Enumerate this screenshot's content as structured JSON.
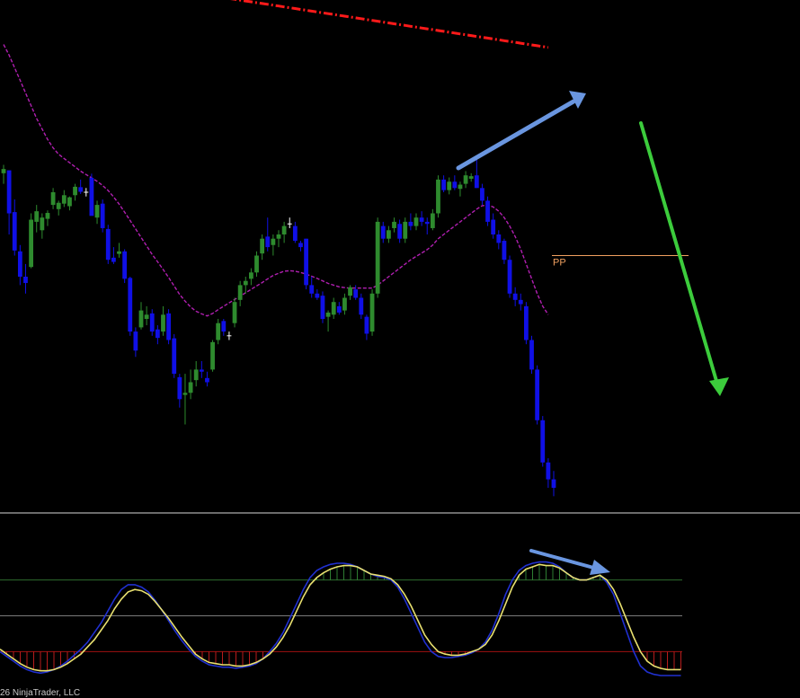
{
  "chart_data": [
    {
      "type": "candlestick",
      "panel": "price",
      "colors": {
        "up": "#2e8b2e",
        "down": "#1010e6",
        "doji": "#ffffff",
        "ma_short": "#b01fb0",
        "ma_long": "#ff1a1a",
        "pp_line": "#f0a060",
        "arrow_up": "#6a96e0",
        "arrow_down": "#3ccc3c"
      },
      "candles": [
        [
          64.5,
          66.5,
          62.0,
          65.5
        ],
        [
          65.2,
          65.0,
          50.0,
          55.0
        ],
        [
          55.3,
          58.3,
          45.0,
          46.2
        ],
        [
          46.0,
          47.5,
          38.0,
          40.0
        ],
        [
          40.0,
          43.0,
          36.0,
          38.5
        ],
        [
          42.3,
          55.0,
          42.0,
          53.5
        ],
        [
          53.0,
          57.0,
          50.5,
          55.5
        ],
        [
          51.0,
          55.0,
          49.0,
          54.0
        ],
        [
          53.7,
          55.7,
          52.0,
          55.1
        ],
        [
          57.0,
          61.0,
          56.0,
          60.0
        ],
        [
          56.0,
          58.0,
          54.5,
          57.5
        ],
        [
          57.3,
          60.5,
          56.5,
          59.3
        ],
        [
          56.7,
          59.0,
          55.7,
          58.8
        ],
        [
          59.3,
          62.0,
          58.0,
          61.3
        ],
        [
          61.2,
          63.0,
          59.6,
          60.1
        ],
        [
          60.0,
          61.0,
          59.0,
          60.0
        ],
        [
          63.4,
          64.4,
          59.0,
          54.4
        ],
        [
          54.0,
          58.0,
          52.5,
          57.0
        ],
        [
          57.3,
          58.3,
          50.5,
          51.5
        ],
        [
          51.3,
          52.3,
          43.0,
          44.0
        ],
        [
          44.5,
          47.0,
          43.0,
          43.5
        ],
        [
          45.4,
          48.0,
          44.5,
          46.0
        ],
        [
          46.0,
          46.5,
          38.5,
          39.5
        ],
        [
          39.7,
          40.0,
          26.0,
          27.0
        ],
        [
          27.0,
          28.0,
          21.0,
          22.5
        ],
        [
          28.0,
          34.0,
          27.5,
          32.0
        ],
        [
          30.0,
          33.0,
          28.5,
          31.0
        ],
        [
          31.3,
          32.3,
          26.0,
          27.0
        ],
        [
          27.5,
          28.5,
          24.0,
          25.5
        ],
        [
          27.0,
          33.0,
          26.0,
          31.0
        ],
        [
          31.3,
          32.3,
          24.0,
          25.0
        ],
        [
          25.4,
          26.4,
          16.0,
          17.0
        ],
        [
          16.2,
          17.0,
          9.0,
          11.0
        ],
        [
          12.0,
          17.0,
          5.0,
          12.5
        ],
        [
          12.5,
          18.0,
          11.0,
          15.0
        ],
        [
          15.5,
          20.0,
          14.0,
          18.0
        ],
        [
          18.0,
          20.0,
          16.0,
          17.5
        ],
        [
          16.0,
          17.5,
          14.0,
          15.0
        ],
        [
          18.0,
          25.0,
          17.5,
          24.5
        ],
        [
          25.0,
          30.0,
          24.0,
          29.0
        ],
        [
          29.5,
          30.0,
          26.0,
          27.0
        ],
        [
          26.0,
          27.0,
          25.0,
          26.0
        ],
        [
          29.0,
          35.0,
          28.0,
          34.0
        ],
        [
          34.5,
          39.0,
          33.0,
          38.0
        ],
        [
          38.0,
          40.0,
          36.0,
          39.0
        ],
        [
          39.5,
          42.0,
          38.0,
          41.0
        ],
        [
          41.0,
          46.0,
          40.0,
          45.0
        ],
        [
          45.5,
          50.0,
          44.0,
          49.0
        ],
        [
          49.5,
          54.0,
          46.0,
          47.0
        ],
        [
          47.5,
          50.0,
          45.0,
          49.0
        ],
        [
          49.0,
          51.0,
          47.0,
          50.0
        ],
        [
          50.0,
          53.0,
          48.0,
          52.0
        ],
        [
          52.5,
          54.0,
          51.5,
          52.5
        ],
        [
          52.0,
          53.0,
          48.0,
          48.5
        ],
        [
          48.0,
          48.5,
          46.0,
          47.0
        ],
        [
          49.0,
          49.0,
          37.0,
          38.0
        ],
        [
          38.0,
          40.0,
          35.0,
          36.0
        ],
        [
          36.0,
          37.0,
          34.5,
          35.0
        ],
        [
          35.5,
          36.5,
          29.0,
          30.0
        ],
        [
          30.5,
          32.0,
          27.0,
          31.5
        ],
        [
          31.0,
          35.0,
          30.0,
          34.0
        ],
        [
          33.0,
          34.0,
          31.0,
          31.5
        ],
        [
          32.0,
          36.0,
          31.0,
          35.0
        ],
        [
          35.5,
          38.0,
          34.5,
          37.5
        ],
        [
          37.0,
          38.0,
          34.5,
          35.0
        ],
        [
          35.0,
          36.0,
          30.0,
          31.0
        ],
        [
          30.5,
          31.0,
          25.0,
          26.5
        ],
        [
          27.0,
          37.0,
          26.0,
          36.0
        ],
        [
          36.0,
          54.0,
          35.0,
          53.0
        ],
        [
          52.0,
          53.0,
          48.0,
          49.0
        ],
        [
          49.0,
          52.0,
          48.0,
          51.0
        ],
        [
          51.5,
          54.0,
          50.5,
          53.0
        ],
        [
          52.5,
          53.5,
          48.0,
          49.0
        ],
        [
          49.0,
          54.0,
          48.0,
          53.0
        ],
        [
          53.0,
          55.0,
          51.0,
          52.0
        ],
        [
          52.0,
          55.0,
          51.0,
          54.0
        ],
        [
          54.0,
          55.5,
          52.0,
          53.0
        ],
        [
          53.0,
          54.0,
          50.0,
          52.5
        ],
        [
          51.5,
          56.0,
          51.0,
          55.0
        ],
        [
          55.0,
          64.0,
          54.0,
          63.0
        ],
        [
          63.0,
          64.0,
          60.0,
          60.5
        ],
        [
          60.5,
          63.5,
          59.5,
          62.5
        ],
        [
          62.5,
          64.0,
          60.5,
          61.0
        ],
        [
          60.8,
          62.5,
          59.0,
          61.8
        ],
        [
          62.0,
          65.0,
          61.0,
          64.0
        ],
        [
          63.2,
          64.5,
          62.5,
          63.8
        ],
        [
          64.0,
          68.0,
          61.0,
          61.0
        ],
        [
          61.0,
          62.0,
          57.0,
          58.0
        ],
        [
          58.0,
          59.0,
          52.0,
          53.0
        ],
        [
          53.5,
          55.0,
          49.0,
          50.0
        ],
        [
          50.0,
          51.0,
          46.5,
          48.0
        ],
        [
          48.5,
          49.0,
          43.0,
          44.0
        ],
        [
          44.0,
          45.0,
          35.0,
          36.0
        ],
        [
          36.0,
          37.5,
          33.0,
          34.5
        ],
        [
          34.5,
          36.0,
          32.0,
          33.5
        ],
        [
          33.0,
          34.0,
          24.0,
          25.0
        ],
        [
          25.0,
          26.0,
          17.0,
          18.0
        ],
        [
          18.0,
          19.0,
          5.0,
          6.0
        ],
        [
          6.0,
          7.0,
          -5.0,
          -4.0
        ],
        [
          -4.0,
          -3.0,
          -10.0,
          -8.0
        ],
        [
          -8.0,
          -6.0,
          -12.0,
          -10.0
        ]
      ],
      "ma_short_values": [
        95.0,
        92.5,
        89.5,
        86.5,
        83.5,
        80.5,
        77.5,
        75.0,
        72.5,
        70.5,
        69.0,
        68.0,
        67.0,
        66.0,
        65.0,
        64.2,
        63.4,
        62.6,
        61.6,
        60.4,
        58.9,
        57.2,
        55.3,
        53.3,
        51.3,
        49.3,
        47.3,
        45.3,
        43.5,
        41.7,
        39.8,
        37.8,
        35.8,
        34.2,
        32.8,
        31.8,
        31.2,
        30.7,
        31.3,
        32.2,
        33.0,
        33.8,
        34.6,
        35.4,
        36.2,
        37.0,
        37.8,
        38.6,
        39.5,
        40.3,
        40.8,
        41.3,
        41.4,
        41.3,
        41.0,
        40.6,
        40.1,
        39.6,
        39.0,
        38.4,
        38.0,
        37.6,
        37.4,
        37.3,
        37.3,
        37.3,
        37.3,
        37.3,
        38.0,
        39.0,
        40.0,
        41.0,
        42.0,
        43.0,
        44.0,
        44.8,
        45.6,
        46.4,
        47.5,
        49.0,
        50.0,
        51.0,
        52.0,
        53.0,
        54.0,
        55.0,
        56.0,
        56.8,
        57.0,
        56.5,
        55.5,
        54.0,
        52.0,
        49.5,
        46.5,
        43.0,
        39.5,
        36.0,
        33.0,
        31.0
      ],
      "ma_long_values": [
        112.0,
        112.2,
        112.4,
        112.6,
        112.7,
        112.8,
        112.8,
        112.7,
        112.5,
        112.3,
        112.1,
        111.9,
        111.7,
        111.5,
        111.3,
        111.1,
        110.9,
        110.7,
        110.5,
        110.3,
        110.1,
        109.9,
        109.7,
        109.5,
        109.3,
        109.1,
        108.9,
        108.7,
        108.5,
        108.3,
        108.1,
        107.9,
        107.7,
        107.5,
        107.3,
        107.1,
        106.9,
        106.7,
        106.5,
        106.3,
        106.1,
        105.9,
        105.7,
        105.5,
        105.3,
        105.1,
        104.9,
        104.7,
        104.5,
        104.3,
        104.1,
        103.9,
        103.7,
        103.5,
        103.3,
        103.1,
        102.9,
        102.7,
        102.5,
        102.3,
        102.1,
        101.9,
        101.7,
        101.5,
        101.3,
        101.1,
        100.9,
        100.7,
        100.5,
        100.3,
        100.1,
        99.9,
        99.7,
        99.5,
        99.3,
        99.1,
        98.9,
        98.7,
        98.5,
        98.3,
        98.1,
        97.9,
        97.7,
        97.5,
        97.3,
        97.1,
        96.9,
        96.7,
        96.5,
        96.3,
        96.1,
        95.9,
        95.7,
        95.5,
        95.3,
        95.1,
        94.9,
        94.7,
        94.5,
        94.3
      ],
      "pivot": {
        "label": "PP",
        "value": 45.0
      }
    },
    {
      "type": "oscillator",
      "panel": "indicator",
      "colors": {
        "signal": "#e8e070",
        "fast": "#2030d0",
        "histogram_pos": "#2e7d32",
        "histogram_neg": "#b71c1c",
        "upper_level": "#2e6b2e",
        "mid_level": "#7a7a7a",
        "lower_level": "#a01010"
      },
      "levels": {
        "upper": 80,
        "mid": 50,
        "lower": 20
      },
      "signal_values": [
        22,
        18,
        14,
        10,
        7,
        5,
        4,
        4,
        5,
        7,
        10,
        14,
        18,
        24,
        30,
        38,
        46,
        56,
        64,
        70,
        72,
        71,
        68,
        62,
        55,
        48,
        40,
        32,
        25,
        18,
        14,
        11,
        10,
        9,
        9,
        8,
        8,
        9,
        11,
        14,
        18,
        24,
        32,
        42,
        54,
        66,
        76,
        82,
        86,
        89,
        91,
        92,
        92,
        91,
        88,
        85,
        84,
        83,
        81,
        76,
        68,
        58,
        46,
        34,
        26,
        20,
        18,
        17,
        17,
        18,
        20,
        22,
        26,
        34,
        46,
        60,
        74,
        84,
        89,
        91,
        93,
        92,
        92,
        90,
        86,
        82,
        80,
        80,
        82,
        84,
        80,
        72,
        60,
        46,
        32,
        20,
        12,
        8,
        6,
        5,
        5,
        5
      ],
      "fast_values": [
        20,
        16,
        12,
        8,
        5,
        3,
        2,
        3,
        5,
        8,
        12,
        17,
        22,
        28,
        36,
        44,
        54,
        64,
        72,
        76,
        76,
        74,
        70,
        63,
        55,
        46,
        37,
        29,
        22,
        16,
        12,
        9,
        8,
        7,
        7,
        6,
        7,
        8,
        10,
        14,
        20,
        27,
        36,
        48,
        60,
        72,
        82,
        88,
        91,
        93,
        94,
        94,
        93,
        91,
        88,
        85,
        83,
        82,
        80,
        74,
        64,
        52,
        40,
        28,
        20,
        16,
        15,
        15,
        16,
        17,
        19,
        22,
        28,
        38,
        52,
        68,
        80,
        88,
        92,
        94,
        95,
        95,
        94,
        91,
        86,
        82,
        80,
        80,
        82,
        84,
        78,
        68,
        52,
        36,
        20,
        8,
        3,
        1,
        0,
        0,
        0,
        0
      ]
    }
  ],
  "footer": {
    "copyright": "26 NinjaTrader, LLC"
  }
}
